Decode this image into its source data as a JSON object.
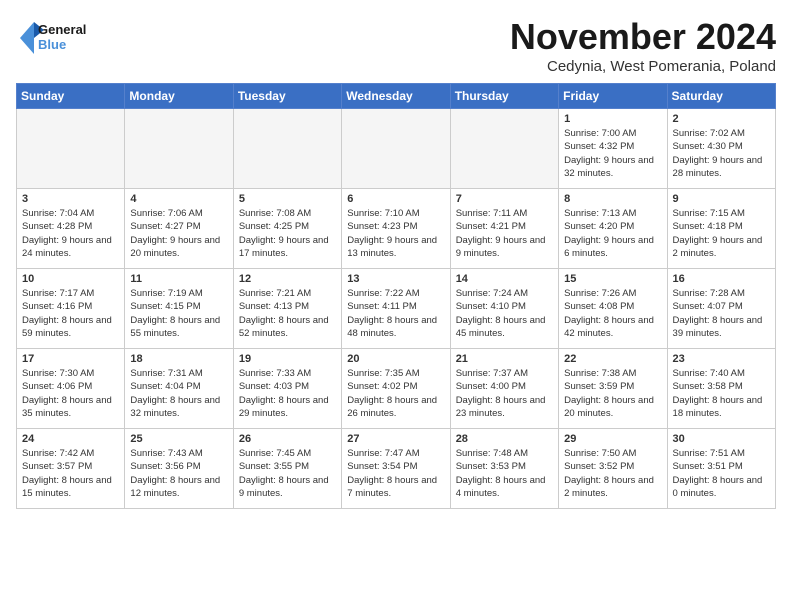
{
  "logo": {
    "text_general": "General",
    "text_blue": "Blue"
  },
  "title": "November 2024",
  "subtitle": "Cedynia, West Pomerania, Poland",
  "days_of_week": [
    "Sunday",
    "Monday",
    "Tuesday",
    "Wednesday",
    "Thursday",
    "Friday",
    "Saturday"
  ],
  "weeks": [
    [
      {
        "day": "",
        "info": "",
        "empty": true
      },
      {
        "day": "",
        "info": "",
        "empty": true
      },
      {
        "day": "",
        "info": "",
        "empty": true
      },
      {
        "day": "",
        "info": "",
        "empty": true
      },
      {
        "day": "",
        "info": "",
        "empty": true
      },
      {
        "day": "1",
        "info": "Sunrise: 7:00 AM\nSunset: 4:32 PM\nDaylight: 9 hours and 32 minutes."
      },
      {
        "day": "2",
        "info": "Sunrise: 7:02 AM\nSunset: 4:30 PM\nDaylight: 9 hours and 28 minutes."
      }
    ],
    [
      {
        "day": "3",
        "info": "Sunrise: 7:04 AM\nSunset: 4:28 PM\nDaylight: 9 hours and 24 minutes."
      },
      {
        "day": "4",
        "info": "Sunrise: 7:06 AM\nSunset: 4:27 PM\nDaylight: 9 hours and 20 minutes."
      },
      {
        "day": "5",
        "info": "Sunrise: 7:08 AM\nSunset: 4:25 PM\nDaylight: 9 hours and 17 minutes."
      },
      {
        "day": "6",
        "info": "Sunrise: 7:10 AM\nSunset: 4:23 PM\nDaylight: 9 hours and 13 minutes."
      },
      {
        "day": "7",
        "info": "Sunrise: 7:11 AM\nSunset: 4:21 PM\nDaylight: 9 hours and 9 minutes."
      },
      {
        "day": "8",
        "info": "Sunrise: 7:13 AM\nSunset: 4:20 PM\nDaylight: 9 hours and 6 minutes."
      },
      {
        "day": "9",
        "info": "Sunrise: 7:15 AM\nSunset: 4:18 PM\nDaylight: 9 hours and 2 minutes."
      }
    ],
    [
      {
        "day": "10",
        "info": "Sunrise: 7:17 AM\nSunset: 4:16 PM\nDaylight: 8 hours and 59 minutes."
      },
      {
        "day": "11",
        "info": "Sunrise: 7:19 AM\nSunset: 4:15 PM\nDaylight: 8 hours and 55 minutes."
      },
      {
        "day": "12",
        "info": "Sunrise: 7:21 AM\nSunset: 4:13 PM\nDaylight: 8 hours and 52 minutes."
      },
      {
        "day": "13",
        "info": "Sunrise: 7:22 AM\nSunset: 4:11 PM\nDaylight: 8 hours and 48 minutes."
      },
      {
        "day": "14",
        "info": "Sunrise: 7:24 AM\nSunset: 4:10 PM\nDaylight: 8 hours and 45 minutes."
      },
      {
        "day": "15",
        "info": "Sunrise: 7:26 AM\nSunset: 4:08 PM\nDaylight: 8 hours and 42 minutes."
      },
      {
        "day": "16",
        "info": "Sunrise: 7:28 AM\nSunset: 4:07 PM\nDaylight: 8 hours and 39 minutes."
      }
    ],
    [
      {
        "day": "17",
        "info": "Sunrise: 7:30 AM\nSunset: 4:06 PM\nDaylight: 8 hours and 35 minutes."
      },
      {
        "day": "18",
        "info": "Sunrise: 7:31 AM\nSunset: 4:04 PM\nDaylight: 8 hours and 32 minutes."
      },
      {
        "day": "19",
        "info": "Sunrise: 7:33 AM\nSunset: 4:03 PM\nDaylight: 8 hours and 29 minutes."
      },
      {
        "day": "20",
        "info": "Sunrise: 7:35 AM\nSunset: 4:02 PM\nDaylight: 8 hours and 26 minutes."
      },
      {
        "day": "21",
        "info": "Sunrise: 7:37 AM\nSunset: 4:00 PM\nDaylight: 8 hours and 23 minutes."
      },
      {
        "day": "22",
        "info": "Sunrise: 7:38 AM\nSunset: 3:59 PM\nDaylight: 8 hours and 20 minutes."
      },
      {
        "day": "23",
        "info": "Sunrise: 7:40 AM\nSunset: 3:58 PM\nDaylight: 8 hours and 18 minutes."
      }
    ],
    [
      {
        "day": "24",
        "info": "Sunrise: 7:42 AM\nSunset: 3:57 PM\nDaylight: 8 hours and 15 minutes."
      },
      {
        "day": "25",
        "info": "Sunrise: 7:43 AM\nSunset: 3:56 PM\nDaylight: 8 hours and 12 minutes."
      },
      {
        "day": "26",
        "info": "Sunrise: 7:45 AM\nSunset: 3:55 PM\nDaylight: 8 hours and 9 minutes."
      },
      {
        "day": "27",
        "info": "Sunrise: 7:47 AM\nSunset: 3:54 PM\nDaylight: 8 hours and 7 minutes."
      },
      {
        "day": "28",
        "info": "Sunrise: 7:48 AM\nSunset: 3:53 PM\nDaylight: 8 hours and 4 minutes."
      },
      {
        "day": "29",
        "info": "Sunrise: 7:50 AM\nSunset: 3:52 PM\nDaylight: 8 hours and 2 minutes."
      },
      {
        "day": "30",
        "info": "Sunrise: 7:51 AM\nSunset: 3:51 PM\nDaylight: 8 hours and 0 minutes."
      }
    ]
  ]
}
